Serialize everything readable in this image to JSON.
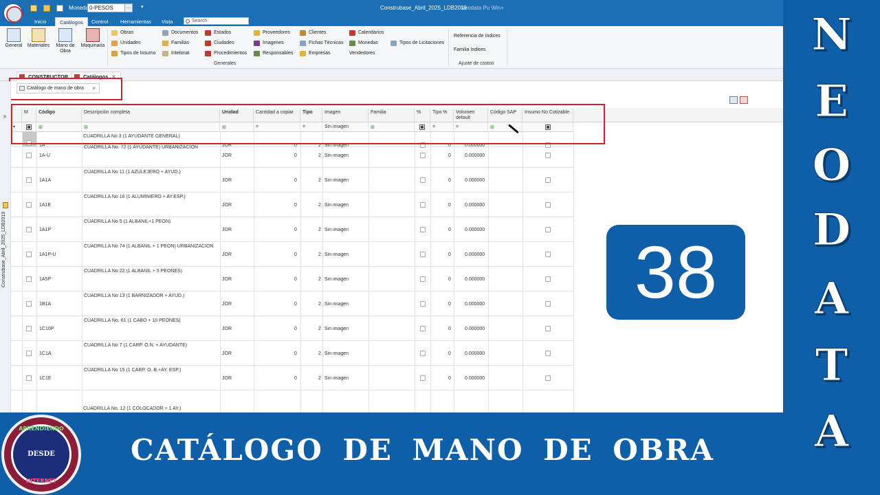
{
  "window": {
    "currency_label": "Moneda",
    "currency_value": "0-PESOS",
    "currency_more": "…",
    "qa_dropdown": "▾",
    "title": "Construbase_Abril_2025_LDB2019",
    "app_name": "Neodata Pu Win+"
  },
  "ribbon_tabs": [
    "Inicio",
    "Catálogos",
    "Control",
    "Herramientas",
    "Vista"
  ],
  "search": {
    "placeholder": "Search"
  },
  "ribbon": {
    "big_buttons": [
      "General",
      "Materiales",
      "Mano de Obra",
      "Maquinaria"
    ],
    "col1": [
      "Obras",
      "Unidades",
      "Tipos de Insumo"
    ],
    "col2": [
      "Documentos",
      "Familias",
      "Intelimat"
    ],
    "col3": [
      "Estados",
      "Ciudades",
      "Procedimientos"
    ],
    "col4": [
      "Proveedores",
      "Imagenes",
      "Responsables"
    ],
    "col5": [
      "Clientes",
      "Fichas Técnicas",
      "Empresas"
    ],
    "col6": [
      "Calendarios",
      "Monedas",
      "Vendedores"
    ],
    "col7": [
      "Tipos de Licitaciones"
    ],
    "group_generales": "Generales",
    "col8": [
      "Referencia de índices",
      "Familia Indices"
    ],
    "group_ajuste": "Ajuste de costos"
  },
  "doc_tabs": {
    "tab1": "CONSTRUCTOR",
    "tab2": "Catálogos",
    "close": "✕"
  },
  "subtab": {
    "label": "Catálogo de mano de obra",
    "close": "×"
  },
  "side_strip": {
    "label": "Construbase_Abril_2025_LDB2019",
    "close": "✕"
  },
  "grid": {
    "headers": [
      "M",
      "Código",
      "Descripción completa",
      "Unidad",
      "Cantidad a copiar",
      "Tipo",
      "Imagen",
      "Familia",
      "%",
      "Tipo %",
      "Volumen default",
      "Código SAP",
      "Insumo No Cotizable"
    ],
    "filter_imagen": "Sin imagen",
    "filter_eq": "=",
    "first_row_desc": "CUADRILLA No  3  (1 AYUDANTE GENERAL)",
    "first_row_code": "1A",
    "rows": [
      {
        "codigo": "1A-U",
        "desc": "CUADRILLA No. 72 (1 AYUDANTE) URBANIZACION"
      },
      {
        "codigo": "1A1A",
        "desc": "CUADRILLA No 11 (1 AZULEJERO + AYUD.)"
      },
      {
        "codigo": "1A1E",
        "desc": "CUADRILLA No 16 (1 ALUMINIERO + AY.ESP.)"
      },
      {
        "codigo": "1A1P",
        "desc": "CUADRILLA No  5  (1 ALBAÑIL+1 PEON)"
      },
      {
        "codigo": "1A1P-U",
        "desc": "CUADRILLA No 74 (1 ALBAÑIL + 1 PEON) URBANIZACION"
      },
      {
        "codigo": "1A5P",
        "desc": "CUADRILLA No 22  (1 ALBAÑIL + 5 PEONES)"
      },
      {
        "codigo": "1B1A",
        "desc": "CUADRILLA No 13 (1 BARNIZADOR + AYUD.)"
      },
      {
        "codigo": "1C10P",
        "desc": "CUADRILLA No. 61 (1 CABO + 10 PEONES)"
      },
      {
        "codigo": "1C1A",
        "desc": "CUADRILLA No  7 (1 CARP. O.N. + AYUDANTE)"
      },
      {
        "codigo": "1C1E",
        "desc": "CUADRILLA No 15 (1 CARP. O. B.+AY. ESP.)"
      }
    ],
    "last_row_desc": "CUADRILLA No. 12 (1 COLOCADOR + 1 AY.)",
    "unidad": "JOR",
    "cantidad": "0",
    "tipo": "2",
    "imagen": "Sin imagen",
    "tipo_pct": "0",
    "volumen": "0.000000"
  },
  "overlay": {
    "side_letters": [
      "N",
      "E",
      "O",
      "D",
      "A",
      "T",
      "A"
    ],
    "caption": "CATÁLOGO DE MANO DE OBRA",
    "episode_number": "38",
    "badge_top": "APRENDIENDO",
    "badge_middle": "DESDE",
    "badge_bottom": "INTERNET"
  },
  "colors": {
    "banner_blue": "#0f5fa8",
    "highlight_red": "#d0202a",
    "titlebar_blue": "#1a6fb5"
  }
}
